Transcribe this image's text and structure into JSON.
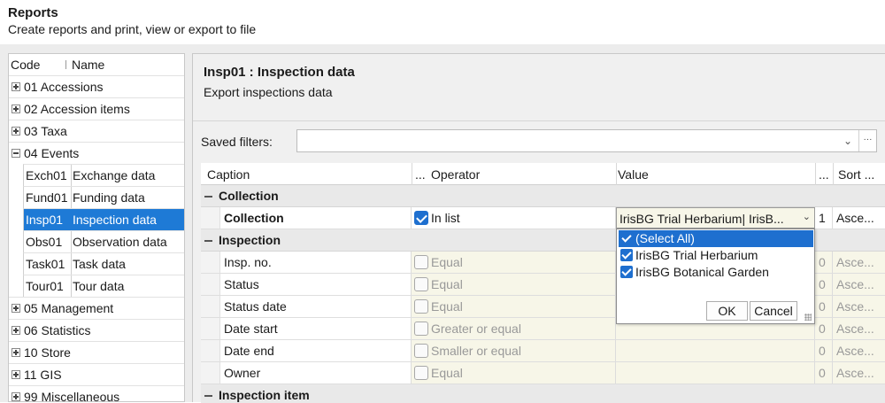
{
  "header": {
    "title": "Reports",
    "subtitle": "Create reports and print, view or export to file"
  },
  "tree": {
    "col_code": "Code",
    "col_name": "Name",
    "nodes": [
      {
        "label": "01 Accessions"
      },
      {
        "label": "02 Accession items"
      },
      {
        "label": "03 Taxa"
      },
      {
        "label": "04 Events"
      }
    ],
    "events_children": [
      {
        "code": "Exch01",
        "name": "Exchange data"
      },
      {
        "code": "Fund01",
        "name": "Funding data"
      },
      {
        "code": "Insp01",
        "name": "Inspection data"
      },
      {
        "code": "Obs01",
        "name": "Observation data"
      },
      {
        "code": "Task01",
        "name": "Task data"
      },
      {
        "code": "Tour01",
        "name": "Tour data"
      }
    ],
    "nodes_after": [
      {
        "label": "05 Management"
      },
      {
        "label": "06 Statistics"
      },
      {
        "label": "10 Store"
      },
      {
        "label": "11 GIS"
      },
      {
        "label": "99 Miscellaneous"
      }
    ]
  },
  "report": {
    "title": "Insp01 : Inspection data",
    "description": "Export inspections data"
  },
  "saved_filters": {
    "label": "Saved filters:",
    "value": "",
    "more_button": "···"
  },
  "grid": {
    "headers": {
      "caption": "Caption",
      "dots1": "...",
      "operator": "Operator",
      "value": "Value",
      "dots2": "...",
      "sort": "Sort ..."
    },
    "groups": [
      {
        "label": "Collection"
      },
      {
        "label": "Inspection"
      },
      {
        "label": "Inspection item"
      }
    ],
    "collection_row": {
      "caption": "Collection",
      "checked": true,
      "operator": "In list",
      "value": "IrisBG Trial Herbarium| IrisB...",
      "num": "1",
      "sort": "Asce..."
    },
    "inspection_rows": [
      {
        "caption": "Insp. no.",
        "operator": "Equal",
        "num": "0",
        "sort": "Asce..."
      },
      {
        "caption": "Status",
        "operator": "Equal",
        "num": "0",
        "sort": "Asce..."
      },
      {
        "caption": "Status date",
        "operator": "Equal",
        "num": "0",
        "sort": "Asce..."
      },
      {
        "caption": "Date start",
        "operator": "Greater or equal",
        "num": "0",
        "sort": "Asce..."
      },
      {
        "caption": "Date end",
        "operator": "Smaller or equal",
        "num": "0",
        "sort": "Asce..."
      },
      {
        "caption": "Owner",
        "operator": "Equal",
        "num": "0",
        "sort": "Asce..."
      }
    ]
  },
  "popup": {
    "options": [
      {
        "label": "(Select All)",
        "checked": true
      },
      {
        "label": "IrisBG Trial Herbarium",
        "checked": true
      },
      {
        "label": "IrisBG Botanical Garden",
        "checked": true
      }
    ],
    "ok_label": "OK",
    "cancel_label": "Cancel"
  },
  "colors": {
    "selection": "#1e7ad6",
    "checkbox": "#1e6fcf",
    "value_bg": "#f7f6e8"
  }
}
